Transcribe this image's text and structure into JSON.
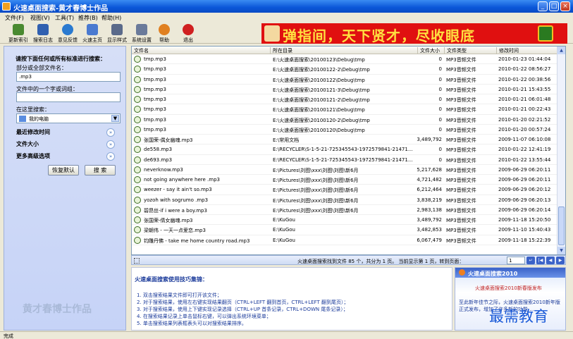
{
  "window": {
    "title": "火速桌面搜索-黄才春博士作品",
    "controls": [
      "minimize",
      "maximize",
      "close"
    ]
  },
  "menu": [
    "文件(F)",
    "视图(V)",
    "工具(T)",
    "推荐(B)",
    "帮助(H)"
  ],
  "toolbar": [
    {
      "label": "更新索引",
      "icon": "update-index-icon",
      "color": "#4a8a30"
    },
    {
      "label": "搜索日志",
      "icon": "search-log-icon",
      "color": "#3060b0"
    },
    {
      "label": "意见反馈",
      "icon": "feedback-icon",
      "color": "#2a7ad0"
    },
    {
      "label": "火速主页",
      "icon": "home-icon",
      "color": "#4a7ad0"
    },
    {
      "label": "显示样式",
      "icon": "display-style-icon",
      "color": "#5a6a8a"
    },
    {
      "label": "系统设置",
      "icon": "settings-icon",
      "color": "#6a7a9a"
    },
    {
      "label": "帮助",
      "icon": "help-icon",
      "color": "#e08020"
    },
    {
      "label": "退出",
      "icon": "exit-icon",
      "color": "#d02020"
    }
  ],
  "banner": {
    "text": "弹指间，天下贤才，尽收眼底"
  },
  "left": {
    "heading": "请按下面任何或所有标准进行搜索：",
    "filename_label": "部分或全部文件名：",
    "filename_value": ".mp3",
    "content_label": "文件中的一个字或词组：",
    "content_value": "",
    "location_label": "在这里搜索：",
    "location_value": "我的电脑",
    "sections": [
      "最近修改时间",
      "文件大小",
      "更多高级选项"
    ],
    "reset_button": "恢复默认",
    "search_button": "搜 索",
    "watermark": "黄才春博士作品"
  },
  "table": {
    "headers": [
      "文件名",
      "所在目录",
      "文件大小",
      "文件类型",
      "修改时间"
    ],
    "rows": [
      {
        "name": "tmp.mp3",
        "path": "E:\\火速桌面搜索\\20100123\\Debug\\tmp",
        "size": "0",
        "type": "MP3音频文件",
        "time": "2010-01-23 01:44:04"
      },
      {
        "name": "tmp.mp3",
        "path": "E:\\火速桌面搜索\\20100122-2\\Debug\\tmp",
        "size": "0",
        "type": "MP3音频文件",
        "time": "2010-01-22 08:56:27"
      },
      {
        "name": "tmp.mp3",
        "path": "E:\\火速桌面搜索\\20100122\\Debug\\tmp",
        "size": "0",
        "type": "MP3音频文件",
        "time": "2010-01-22 00:38:56"
      },
      {
        "name": "tmp.mp3",
        "path": "E:\\火速桌面搜索\\20100121-3\\Debug\\tmp",
        "size": "0",
        "type": "MP3音频文件",
        "time": "2010-01-21 15:43:55"
      },
      {
        "name": "tmp.mp3",
        "path": "E:\\火速桌面搜索\\20100121-2\\Debug\\tmp",
        "size": "0",
        "type": "MP3音频文件",
        "time": "2010-01-21 06:01:48"
      },
      {
        "name": "tmp.mp3",
        "path": "E:\\火速桌面搜索\\20100121\\Debug\\tmp",
        "size": "0",
        "type": "MP3音频文件",
        "time": "2010-01-21 00:22:43"
      },
      {
        "name": "tmp.mp3",
        "path": "E:\\火速桌面搜索\\20100120-2\\Debug\\tmp",
        "size": "0",
        "type": "MP3音频文件",
        "time": "2010-01-20 02:21:52"
      },
      {
        "name": "tmp.mp3",
        "path": "E:\\火速桌面搜索\\20100120\\Debug\\tmp",
        "size": "0",
        "type": "MP3音频文件",
        "time": "2010-01-20 00:57:24"
      },
      {
        "name": "张国荣-偶女幽魂.mp3",
        "path": "E:\\常用文档",
        "size": "3,489,792",
        "type": "MP3音频文件",
        "time": "2009-11-07 06:10:08"
      },
      {
        "name": "de558.mp3",
        "path": "E:\\RECYCLER\\S-1-5-21-725345543-1972579841-21471...",
        "size": "0",
        "type": "MP3音频文件",
        "time": "2010-01-22 12:41:19"
      },
      {
        "name": "de693.mp3",
        "path": "E:\\RECYCLER\\S-1-5-21-725345543-1972579841-21471...",
        "size": "0",
        "type": "MP3音频文件",
        "time": "2010-01-22 13:55:44"
      },
      {
        "name": "neverknow.mp3",
        "path": "E:\\Pictures\\刘图\\xxx\\刘图\\刘图\\新6月",
        "size": "5,217,628",
        "type": "MP3音频文件",
        "time": "2009-06-29 06:20:11"
      },
      {
        "name": "not going anywhere here .mp3",
        "path": "E:\\Pictures\\刘图\\xxx\\刘图\\刘图\\新6月",
        "size": "4,721,482",
        "type": "MP3音频文件",
        "time": "2009-06-29 06:20:11"
      },
      {
        "name": "weezer - say it ain't so.mp3",
        "path": "E:\\Pictures\\刘图\\xxx\\刘图\\刘图\\新6月",
        "size": "6,212,464",
        "type": "MP3音频文件",
        "time": "2009-06-29 06:20:12"
      },
      {
        "name": "yozoh with sogrumo .mp3",
        "path": "E:\\Pictures\\刘图\\xxx\\刘图\\刘图\\新6月",
        "size": "3,838,219",
        "type": "MP3音频文件",
        "time": "2009-06-29 06:20:13"
      },
      {
        "name": "碧昂丝-if i were a boy.mp3",
        "path": "E:\\Pictures\\刘图\\xxx\\刘图\\刘图\\新6月",
        "size": "2,983,138",
        "type": "MP3音频文件",
        "time": "2009-06-29 06:20:14"
      },
      {
        "name": "张国荣-倩女幽魂.mp3",
        "path": "E:\\KuGou",
        "size": "3,489,792",
        "type": "MP3音频文件",
        "time": "2009-11-18 15:20:50"
      },
      {
        "name": "梁朝伟 - 一天一点爱恋.mp3",
        "path": "E:\\KuGou",
        "size": "3,482,853",
        "type": "MP3音频文件",
        "time": "2009-11-10 15:40:43"
      },
      {
        "name": "钧雕丹佛 - take me home country road.mp3",
        "path": "E:\\KuGou",
        "size": "6,067,479",
        "type": "MP3音频文件",
        "time": "2009-11-18 15:22:39"
      }
    ]
  },
  "status": {
    "summary": "火速桌面搜索找到文件 85 个，共分为 1 页。  当前显示第 1 页，转到页面：",
    "page_value": "1"
  },
  "tips": {
    "title": "火速桌面搜索使用技巧集锦：",
    "lines": [
      "1. 双击搜索结果文件即可打开该文件；",
      "2. 对于搜索结果，使用左右键实现结果翻页（CTRL+LEFT 翻到首页，CTRL+LEFT 翻到尾页）；",
      "3. 对于搜索结果，使用上下键实现记录选择（CTRL+UP  首条记录，CTRL+DOWN 尾条记录）；",
      "4. 在搜索结果记录上单击鼠标右键，可以弹出系统环境菜单；",
      "5. 单击搜索结果列表框表头可以对搜索结果排序。"
    ]
  },
  "promo": {
    "title": "火速桌面搜索2010",
    "subtitle": "火速桌面搜索2010新春版发布",
    "body": "至此新年佳节之际，火速桌面搜索2010新年版正式发布，增加了许多新的功能……",
    "watermark": "最需教育"
  },
  "statusbar": {
    "text": "完成"
  }
}
